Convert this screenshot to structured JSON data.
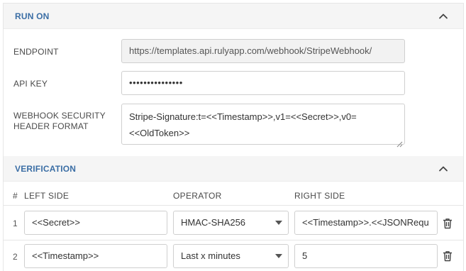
{
  "run_on": {
    "title": "RUN ON",
    "endpoint_label": "ENDPOINT",
    "endpoint_value": "https://templates.api.rulyapp.com/webhook/StripeWebhook/",
    "api_key_label": "API KEY",
    "api_key_value": "•••••••••••••••",
    "security_label_line1": "WEBHOOK SECURITY",
    "security_label_line2": "HEADER FORMAT",
    "security_line1": "Stripe-Signature:t=<<Timestamp>>,v1=<<Secret>>,v0=",
    "security_line2": "<<OldToken>>"
  },
  "verification": {
    "title": "VERIFICATION",
    "columns": {
      "num": "#",
      "left": "LEFT SIDE",
      "operator": "OPERATOR",
      "right": "RIGHT SIDE"
    },
    "rows": [
      {
        "num": "1",
        "left": "<<Secret>>",
        "operator": "HMAC-SHA256",
        "right": "<<Timestamp>>.<<JSONRequ"
      },
      {
        "num": "2",
        "left": "<<Timestamp>>",
        "operator": "Last x minutes",
        "right": "5"
      }
    ]
  },
  "icons": {
    "collapse": "chevron-up-icon",
    "delete": "trash-icon",
    "dropdown": "caret-down-icon"
  },
  "colors": {
    "accent": "#3b6ea5",
    "header_bg": "#f5f5f5",
    "border": "#cfcfcf"
  }
}
